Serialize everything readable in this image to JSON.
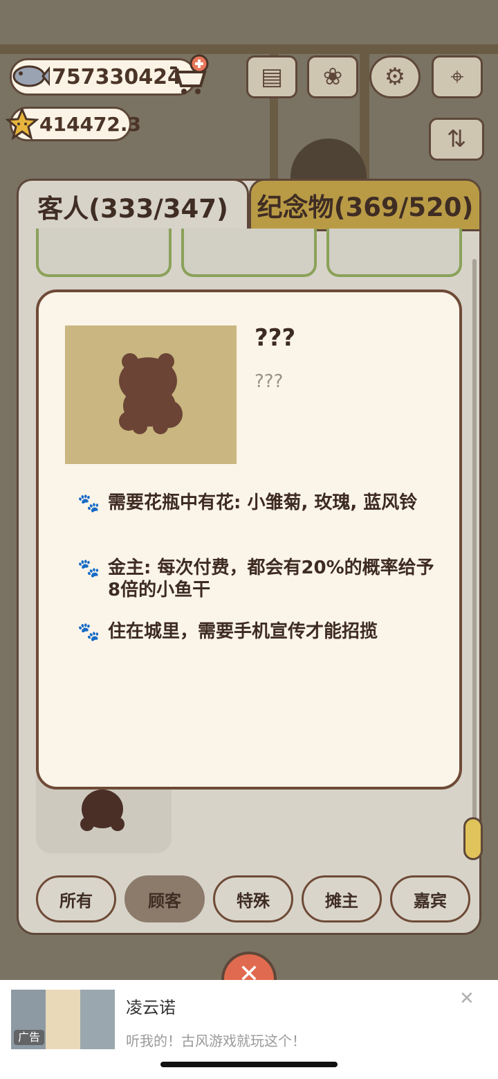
{
  "hud": {
    "fish_count": "757330424",
    "star_count": "414472.3"
  },
  "tabs": {
    "guests": "客人(333/347)",
    "souvenirs": "纪念物(369/520)"
  },
  "detail": {
    "name": "???",
    "description": "???",
    "traits": [
      "需要花瓶中有花: 小雏菊, 玫瑰, 蓝风铃",
      "金主: 每次付费，都会有20%的概率给予8倍的小鱼干",
      "住在城里，需要手机宣传才能招揽"
    ]
  },
  "filters": [
    "所有",
    "顾客",
    "特殊",
    "摊主",
    "嘉宾"
  ],
  "selected_filter": "顾客",
  "ad": {
    "title": "凌云诺",
    "subtitle": "听我的！古风游戏就玩这个！",
    "badge": "广告"
  },
  "colors": {
    "panel_border": "#5e4739",
    "tab_inactive": "#b99b46",
    "card_border": "#8aa259",
    "modal_bg": "#fbf4e9",
    "silhouette": "#6b4436"
  },
  "icons": [
    "fish-icon",
    "cart-plus-icon",
    "star-face-icon",
    "news-icon",
    "book-icon",
    "gear-icon",
    "map-icon",
    "sort-icon",
    "paw-icon",
    "close-icon"
  ]
}
